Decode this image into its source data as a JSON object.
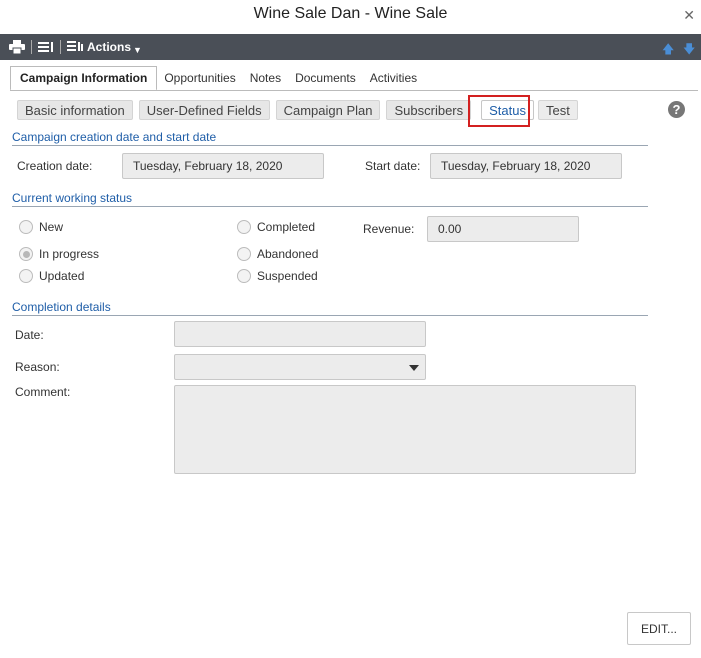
{
  "window": {
    "title": "Wine Sale Dan - Wine Sale",
    "close_icon": "close-icon"
  },
  "toolbar": {
    "print_icon": "print-icon",
    "list_icon": "list-icon",
    "actions_icon": "actions-list-icon",
    "actions_label": "Actions",
    "up_icon": "arrow-up-icon",
    "down_icon": "arrow-down-icon"
  },
  "tabs": [
    {
      "label": "Campaign Information",
      "active": true
    },
    {
      "label": "Opportunities"
    },
    {
      "label": "Notes"
    },
    {
      "label": "Documents"
    },
    {
      "label": "Activities"
    }
  ],
  "subtabs": [
    {
      "label": "Basic information"
    },
    {
      "label": "User-Defined Fields"
    },
    {
      "label": "Campaign Plan"
    },
    {
      "label": "Subscribers"
    },
    {
      "label": "Status",
      "active": true
    },
    {
      "label": "Test"
    }
  ],
  "help_label": "?",
  "dates_section": {
    "title": "Campaign creation date and start date",
    "creation_label": "Creation date:",
    "creation_value": "Tuesday, February 18, 2020",
    "start_label": "Start date:",
    "start_value": "Tuesday, February 18, 2020"
  },
  "status_section": {
    "title": "Current working status",
    "options": [
      {
        "label": "New",
        "checked": false
      },
      {
        "label": "In progress",
        "checked": true
      },
      {
        "label": "Updated",
        "checked": false
      },
      {
        "label": "Completed",
        "checked": false
      },
      {
        "label": "Abandoned",
        "checked": false
      },
      {
        "label": "Suspended",
        "checked": false
      }
    ],
    "revenue_label": "Revenue:",
    "revenue_value": "0.00"
  },
  "completion_section": {
    "title": "Completion details",
    "date_label": "Date:",
    "date_value": "",
    "reason_label": "Reason:",
    "reason_value": "",
    "comment_label": "Comment:",
    "comment_value": ""
  },
  "edit_button": "EDIT...",
  "colors": {
    "toolbar_bg": "#4a4f57",
    "section_title": "#1f5ea8",
    "highlight": "#d32020"
  }
}
